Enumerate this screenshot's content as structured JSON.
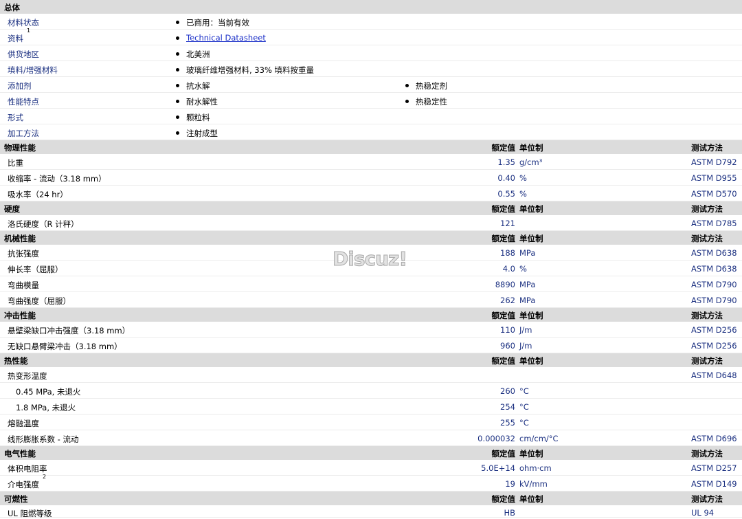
{
  "general": {
    "header": "总体",
    "rows": [
      {
        "label": "材料状态",
        "values": [
          "已商用：当前有效"
        ]
      },
      {
        "label": "资料",
        "sup": "1",
        "values": [
          "Technical Datasheet"
        ],
        "link": true
      },
      {
        "label": "供货地区",
        "values": [
          "北美洲"
        ]
      },
      {
        "label": "填料/增强材料",
        "values": [
          "玻璃纤维增强材料, 33% 填料按重量"
        ]
      },
      {
        "label": "添加剂",
        "values": [
          "抗水解",
          "热稳定剂"
        ]
      },
      {
        "label": "性能特点",
        "values": [
          "耐水解性",
          "热稳定性"
        ]
      },
      {
        "label": "形式",
        "values": [
          "颗粒料"
        ]
      },
      {
        "label": "加工方法",
        "values": [
          "注射成型"
        ]
      }
    ]
  },
  "column_labels": {
    "value": "额定值",
    "unit": "单位制",
    "method": "测试方法"
  },
  "sections": [
    {
      "title": "物理性能",
      "rows": [
        {
          "label": "比重",
          "value": "1.35",
          "unit": "g/cm³",
          "method": "ASTM D792"
        },
        {
          "label": "收缩率 - 流动（3.18 mm）",
          "value": "0.40",
          "unit": "%",
          "method": "ASTM D955"
        },
        {
          "label": "吸水率（24 hr）",
          "value": "0.55",
          "unit": "%",
          "method": "ASTM D570"
        }
      ]
    },
    {
      "title": "硬度",
      "rows": [
        {
          "label": "洛氏硬度（R 计秤）",
          "value": "121",
          "unit": "",
          "method": "ASTM D785"
        }
      ]
    },
    {
      "title": "机械性能",
      "rows": [
        {
          "label": "抗张强度",
          "value": "188",
          "unit": "MPa",
          "method": "ASTM D638"
        },
        {
          "label": "伸长率（屈服）",
          "value": "4.0",
          "unit": "%",
          "method": "ASTM D638"
        },
        {
          "label": "弯曲模量",
          "value": "8890",
          "unit": "MPa",
          "method": "ASTM D790"
        },
        {
          "label": "弯曲强度（屈服）",
          "value": "262",
          "unit": "MPa",
          "method": "ASTM D790"
        }
      ]
    },
    {
      "title": "冲击性能",
      "rows": [
        {
          "label": "悬壁梁缺口冲击强度（3.18 mm）",
          "value": "110",
          "unit": "J/m",
          "method": "ASTM D256"
        },
        {
          "label": "无缺口悬臂梁冲击（3.18 mm）",
          "value": "960",
          "unit": "J/m",
          "method": "ASTM D256"
        }
      ]
    },
    {
      "title": "热性能",
      "rows": [
        {
          "label": "热变形温度",
          "value": "",
          "unit": "",
          "method": "ASTM D648"
        },
        {
          "label": "0.45 MPa, 未退火",
          "value": "260",
          "unit": "°C",
          "method": "",
          "indent": true
        },
        {
          "label": "1.8 MPa, 未退火",
          "value": "254",
          "unit": "°C",
          "method": "",
          "indent": true
        },
        {
          "label": "熔融温度",
          "value": "255",
          "unit": "°C",
          "method": ""
        },
        {
          "label": "线形膨胀系数 - 流动",
          "value": "0.000032",
          "unit": "cm/cm/°C",
          "method": "ASTM D696"
        }
      ]
    },
    {
      "title": "电气性能",
      "rows": [
        {
          "label": "体积电阻率",
          "value": "5.0E+14",
          "unit": "ohm·cm",
          "method": "ASTM D257"
        },
        {
          "label": "介电强度",
          "sup": "2",
          "value": "19",
          "unit": "kV/mm",
          "method": "ASTM D149"
        }
      ]
    },
    {
      "title": "可燃性",
      "rows": [
        {
          "label": "UL 阻燃等级",
          "value": "HB",
          "unit": "",
          "method": "UL 94"
        }
      ]
    }
  ],
  "watermark": "Discuz!"
}
